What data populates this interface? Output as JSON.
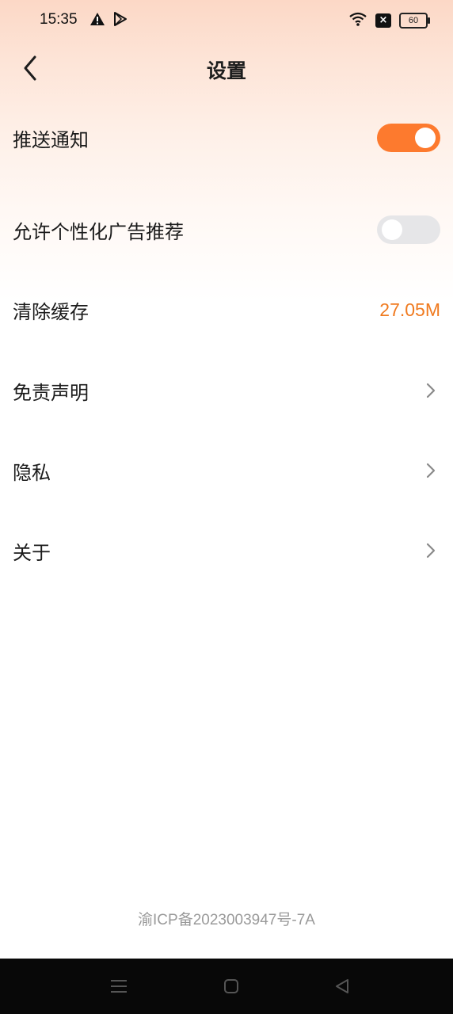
{
  "status_bar": {
    "time": "15:35",
    "left_icons": [
      "warning-icon",
      "play-store-icon"
    ],
    "right_icons": [
      "wifi-icon",
      "close-badge-icon",
      "battery-icon"
    ],
    "battery_level": "60"
  },
  "header": {
    "title": "设置",
    "back_icon": "chevron-left-icon"
  },
  "settings": {
    "push_notification": {
      "label": "推送通知",
      "enabled": true
    },
    "personalized_ads": {
      "label": "允许个性化广告推荐",
      "enabled": false
    },
    "clear_cache": {
      "label": "清除缓存",
      "value": "27.05M"
    },
    "disclaimer": {
      "label": "免责声明"
    },
    "privacy": {
      "label": "隐私"
    },
    "about": {
      "label": "关于"
    }
  },
  "footer": {
    "icp": "渝ICP备2023003947号-7A"
  },
  "colors": {
    "accent": "#fd7a2e",
    "cache_value": "#f07a1f",
    "toggle_off": "#e6e6e8",
    "text_primary": "#1b1b1b",
    "text_muted": "#9a9a9a"
  },
  "system_nav": [
    "menu-icon",
    "home-icon",
    "back-triangle-icon"
  ]
}
